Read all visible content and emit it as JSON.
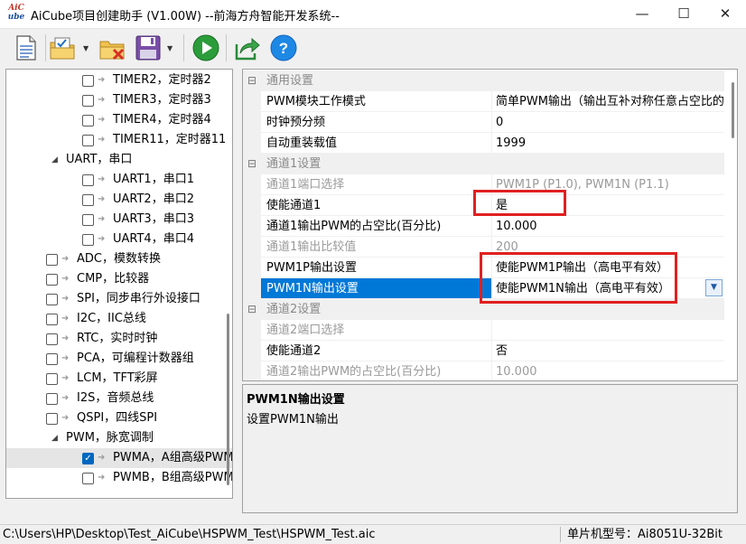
{
  "window": {
    "title": "AiCube项目创建助手 (V1.00W) --前海方舟智能开发系统--",
    "logo_line1": "AiC",
    "logo_line2": "ube",
    "minimize": "—",
    "maximize": "☐",
    "close": "✕"
  },
  "toolbar": {
    "buttons": [
      "new-project",
      "open-project",
      "close-project",
      "save-project",
      "run",
      "export",
      "help"
    ],
    "help_glyph": "?"
  },
  "tree": {
    "items": [
      {
        "label": "TIMER2，定时器2",
        "checked": false
      },
      {
        "label": "TIMER3，定时器3",
        "checked": false
      },
      {
        "label": "TIMER4，定时器4",
        "checked": false
      },
      {
        "label": "TIMER11，定时器11",
        "checked": false
      },
      {
        "label": "UART，串口",
        "group": true
      },
      {
        "label": "UART1，串口1",
        "checked": false
      },
      {
        "label": "UART2，串口2",
        "checked": false
      },
      {
        "label": "UART3，串口3",
        "checked": false
      },
      {
        "label": "UART4，串口4",
        "checked": false
      },
      {
        "label": "ADC，模数转换",
        "checked": false
      },
      {
        "label": "CMP，比较器",
        "checked": false
      },
      {
        "label": "SPI，同步串行外设接口",
        "checked": false
      },
      {
        "label": "I2C，IIC总线",
        "checked": false
      },
      {
        "label": "RTC，实时时钟",
        "checked": false
      },
      {
        "label": "PCA，可编程计数器组",
        "checked": false
      },
      {
        "label": "LCM，TFT彩屏",
        "checked": false
      },
      {
        "label": "I2S，音频总线",
        "checked": false
      },
      {
        "label": "QSPI，四线SPI",
        "checked": false
      },
      {
        "label": "PWM，脉宽调制",
        "group": true
      },
      {
        "label": "PWMA，A组高级PWM",
        "checked": true,
        "selected": true
      },
      {
        "label": "PWMB，B组高级PWM",
        "checked": false
      }
    ]
  },
  "grid": {
    "rows": [
      {
        "kind": "cat",
        "name": "通用设置",
        "toggle": "⊟"
      },
      {
        "name": "PWM模块工作模式",
        "value": "简单PWM输出（输出互补对称任意占空比的PWM）"
      },
      {
        "name": "时钟预分频",
        "value": "0"
      },
      {
        "name": "自动重装载值",
        "value": "1999"
      },
      {
        "kind": "cat",
        "name": "通道1设置",
        "toggle": "⊟"
      },
      {
        "name": "通道1端口选择",
        "value": "PWM1P (P1.0), PWM1N (P1.1)",
        "disabled": true
      },
      {
        "name": "使能通道1",
        "value": "是"
      },
      {
        "name": "通道1输出PWM的占空比(百分比)",
        "value": "10.000"
      },
      {
        "name": "通道1输出比较值",
        "value": "200",
        "disabled": true
      },
      {
        "name": "PWM1P输出设置",
        "value": "使能PWM1P输出（高电平有效）"
      },
      {
        "name": "PWM1N输出设置",
        "value": "使能PWM1N输出（高电平有效）",
        "selected": true
      },
      {
        "kind": "cat",
        "name": "通道2设置",
        "toggle": "⊟"
      },
      {
        "name": "通道2端口选择",
        "value": "",
        "disabled": true
      },
      {
        "name": "使能通道2",
        "value": "否"
      },
      {
        "name": "通道2输出PWM的占空比(百分比)",
        "value": "10.000",
        "disabled": true
      }
    ]
  },
  "description": {
    "title": "PWM1N输出设置",
    "text": "设置PWM1N输出"
  },
  "status": {
    "path": "C:\\Users\\HP\\Desktop\\Test_AiCube\\HSPWM_Test\\HSPWM_Test.aic",
    "mcu_label": "单片机型号：",
    "mcu_value": "Ai8051U-32Bit"
  },
  "colors": {
    "selection": "#0078d7",
    "annotation": "#e02020",
    "run_green": "#2a9d3a",
    "help_blue": "#1e88e5"
  }
}
